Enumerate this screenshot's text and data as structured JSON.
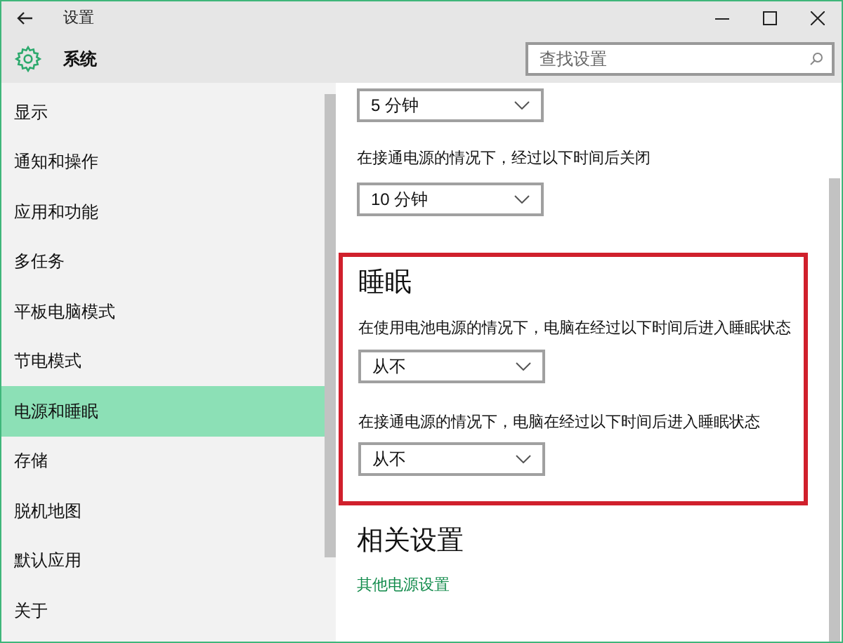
{
  "window": {
    "title": "设置"
  },
  "header": {
    "title": "系统",
    "search": {
      "placeholder": "查找设置"
    }
  },
  "sidebar": {
    "items": [
      {
        "label": "显示",
        "selected": false
      },
      {
        "label": "通知和操作",
        "selected": false
      },
      {
        "label": "应用和功能",
        "selected": false
      },
      {
        "label": "多任务",
        "selected": false
      },
      {
        "label": "平板电脑模式",
        "selected": false
      },
      {
        "label": "节电模式",
        "selected": false
      },
      {
        "label": "电源和睡眠",
        "selected": true
      },
      {
        "label": "存储",
        "selected": false
      },
      {
        "label": "脱机地图",
        "selected": false
      },
      {
        "label": "默认应用",
        "selected": false
      },
      {
        "label": "关于",
        "selected": false
      }
    ]
  },
  "content": {
    "top_dropdown": {
      "value": "5 分钟"
    },
    "screen_plugged": {
      "label": "在接通电源的情况下，经过以下时间后关闭",
      "value": "10 分钟"
    },
    "sleep": {
      "heading": "睡眠",
      "highlighted": true,
      "settings": [
        {
          "label": "在使用电池电源的情况下，电脑在经过以下时间后进入睡眠状态",
          "value": "从不"
        },
        {
          "label": "在接通电源的情况下，电脑在经过以下时间后进入睡眠状态",
          "value": "从不"
        }
      ]
    },
    "related": {
      "heading": "相关设置",
      "link": "其他电源设置"
    }
  }
}
